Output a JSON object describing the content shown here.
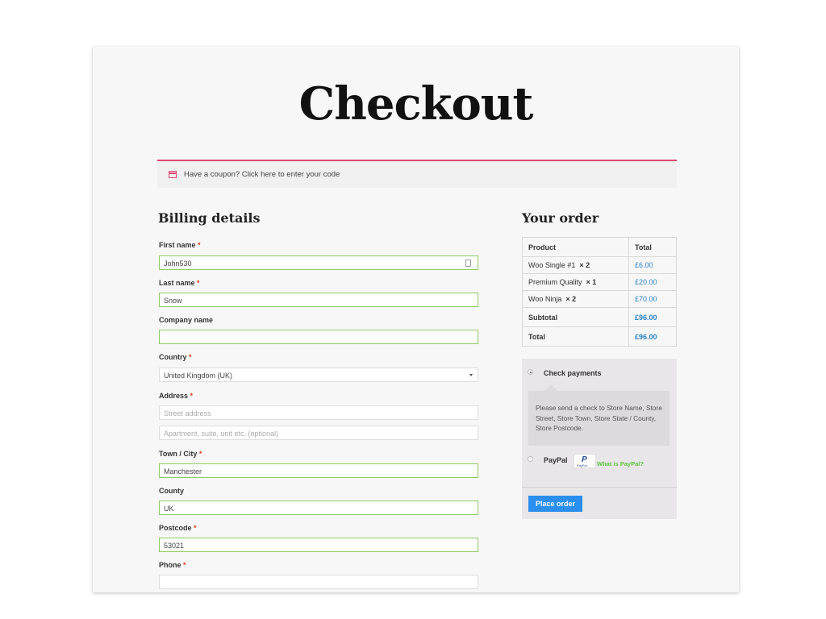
{
  "page": {
    "title": "Checkout"
  },
  "coupon": {
    "prefix": "Have a coupon?",
    "link": "Click here to enter your code"
  },
  "billing": {
    "heading": "Billing details",
    "fields": {
      "first_name": {
        "label": "First name",
        "value": "John530"
      },
      "last_name": {
        "label": "Last name",
        "value": "Snow"
      },
      "company": {
        "label": "Company name",
        "value": ""
      },
      "country": {
        "label": "Country",
        "value": "United Kingdom (UK)"
      },
      "address": {
        "label": "Address",
        "placeholder1": "Street address",
        "placeholder2": "Apartment, suite, unit etc. (optional)"
      },
      "city": {
        "label": "Town / City",
        "value": "Manchester"
      },
      "county": {
        "label": "County",
        "value": "UK"
      },
      "postcode": {
        "label": "Postcode",
        "value": "53021"
      },
      "phone": {
        "label": "Phone",
        "value": ""
      }
    },
    "required_mark": "*"
  },
  "order": {
    "heading": "Your order",
    "columns": [
      "Product",
      "Total"
    ],
    "items": [
      {
        "name": "Woo Single #1",
        "qty": "× 2",
        "total": "£6.00"
      },
      {
        "name": "Premium Quality",
        "qty": "× 1",
        "total": "£20.00"
      },
      {
        "name": "Woo Ninja",
        "qty": "× 2",
        "total": "£70.00"
      }
    ],
    "subtotal_label": "Subtotal",
    "subtotal": "£96.00",
    "total_label": "Total",
    "total": "£96.00"
  },
  "payment": {
    "check_label": "Check payments",
    "check_description": "Please send a check to Store Name, Store Street, Store Town, Store State / County, Store Postcode.",
    "paypal_label": "PayPal",
    "paypal_link": "What is PayPal?",
    "paypal_logo_letter": "P",
    "paypal_logo_text": "PayPal",
    "place_order": "Place order"
  }
}
